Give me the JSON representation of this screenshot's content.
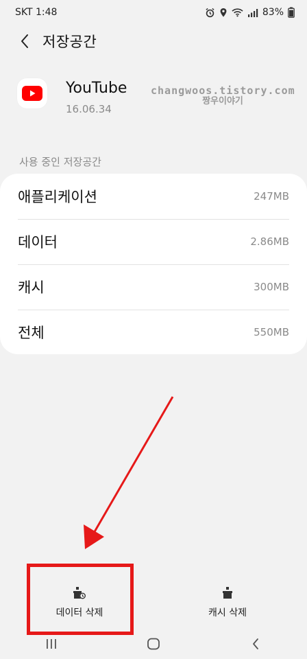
{
  "status": {
    "carrier_time": "SKT 1:48",
    "battery": "83%"
  },
  "header": {
    "title": "저장공간"
  },
  "app": {
    "name": "YouTube",
    "version": "16.06.34"
  },
  "watermark": {
    "line1": "changwoos.tistory.com",
    "line2": "짱우이야기"
  },
  "storage": {
    "section_label": "사용 중인 저장공간",
    "rows": [
      {
        "label": "애플리케이션",
        "value": "247MB"
      },
      {
        "label": "데이터",
        "value": "2.86MB"
      },
      {
        "label": "캐시",
        "value": "300MB"
      },
      {
        "label": "전체",
        "value": "550MB"
      }
    ]
  },
  "actions": {
    "delete_data": "데이터 삭제",
    "delete_cache": "캐시 삭제"
  },
  "colors": {
    "accent_red": "#e61919",
    "youtube_red": "#ff0000"
  }
}
